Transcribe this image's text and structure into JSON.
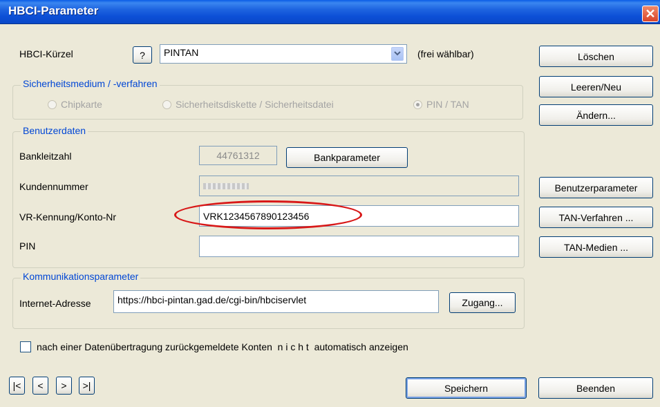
{
  "window": {
    "title": "HBCI-Parameter",
    "close_glyph": "✕"
  },
  "hbci": {
    "label": "HBCI-Kürzel",
    "help_label": "?",
    "value": "PINTAN",
    "hint": "(frei wählbar)"
  },
  "security": {
    "legend": "Sicherheitsmedium / -verfahren",
    "options": [
      "Chipkarte",
      "Sicherheitsdiskette / Sicherheitsdatei",
      "PIN / TAN"
    ],
    "selected": "PIN / TAN"
  },
  "user": {
    "legend": "Benutzerdaten",
    "blz_label": "Bankleitzahl",
    "blz_value": "44761312",
    "bankparam_label": "Bankparameter",
    "kundennr_label": "Kundennummer",
    "vr_label": "VR-Kennung/Konto-Nr",
    "vr_value": "VRK1234567890123456",
    "pin_label": "PIN",
    "pin_value": ""
  },
  "comm": {
    "legend": "Kommunikationsparameter",
    "url_label": "Internet-Adresse",
    "url_value": "https://hbci-pintan.gad.de/cgi-bin/hbciservlet",
    "access_label": "Zugang..."
  },
  "checkbox_label": "nach einer Datenübertragung zurückgemeldete Konten  n i c h t  automatisch anzeigen",
  "side_buttons": {
    "delete": "Löschen",
    "clear_new": "Leeren/Neu",
    "change": "Ändern...",
    "user_params": "Benutzerparameter",
    "tan_method": "TAN-Verfahren ...",
    "tan_media": "TAN-Medien ..."
  },
  "nav": {
    "first": "|<",
    "prev": "<",
    "next": ">",
    "last": ">|"
  },
  "footer": {
    "save": "Speichern",
    "close": "Beenden"
  }
}
